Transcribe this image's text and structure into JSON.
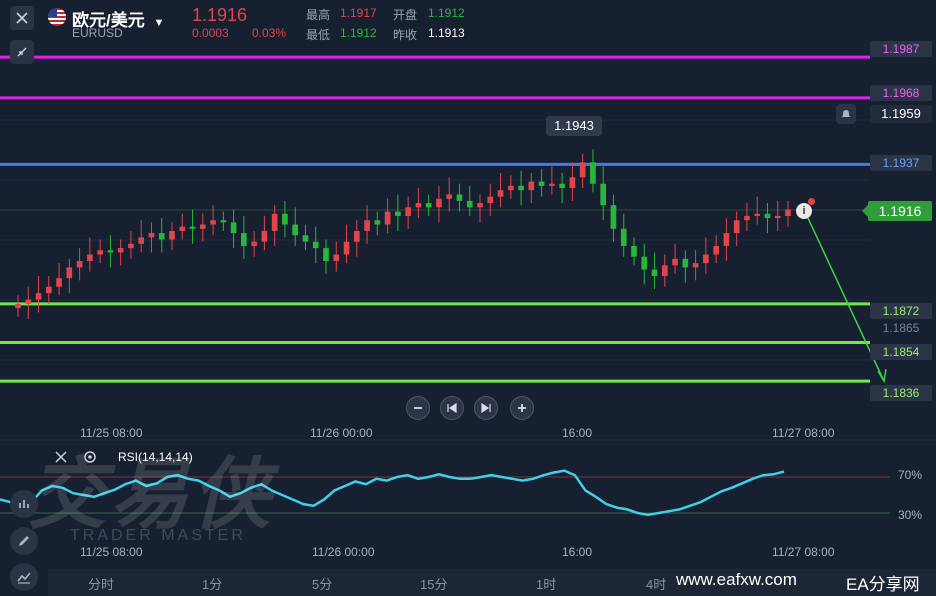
{
  "header": {
    "symbol_name": "欧元/美元",
    "symbol_code": "EURUSD",
    "price": "1.1916",
    "change": "0.0003",
    "change_pct": "0.03%",
    "high_label": "最高",
    "high_value": "1.1917",
    "open_label": "开盘",
    "open_value": "1.1912",
    "low_label": "最低",
    "low_value": "1.1912",
    "prev_close_label": "昨收",
    "prev_close_value": "1.1913"
  },
  "price_levels": {
    "level_1987": "1.1987",
    "level_1968": "1.1968",
    "alert_price": "1.1959",
    "level_1937": "1.1937",
    "current": "1.1916",
    "level_1872": "1.1872",
    "level_1865": "1.1865",
    "level_1854": "1.1854",
    "level_1836": "1.1836"
  },
  "chart_annotation": {
    "peak_label": "1.1943"
  },
  "time_axis": [
    "11/25 08:00",
    "11/26 00:00",
    "16:00",
    "11/27 08:00"
  ],
  "indicator": {
    "name": "RSI(14,14,14)",
    "level_high": "70%",
    "level_low": "30%"
  },
  "timeframe_tabs": [
    "分时",
    "1分",
    "5分",
    "15分",
    "1时",
    "4时"
  ],
  "watermark": {
    "main": "交易侠",
    "sub": "TRADER MASTER"
  },
  "footer_brand": {
    "url": "www.eafxw.com",
    "name": "EA分享网"
  },
  "colors": {
    "up": "#e0454a",
    "down": "#27b83a",
    "magenta_line": "#e020e8",
    "blue_line": "#3d7df0",
    "green_line": "#6ee84a",
    "rsi_line": "#3fd0e8"
  },
  "chart_data": {
    "type": "candlestick",
    "symbol": "EURUSD",
    "ylim": [
      1.183,
      1.1995
    ],
    "horizontal_levels": [
      1.1987,
      1.1968,
      1.1937,
      1.1872,
      1.1854,
      1.1836
    ],
    "current_price": 1.1916,
    "peak": 1.1943,
    "x_ticks": [
      "11/25 08:00",
      "11/26 00:00",
      "16:00",
      "11/27 08:00"
    ],
    "close_series": [
      1.1872,
      1.1874,
      1.1877,
      1.188,
      1.1884,
      1.1889,
      1.1892,
      1.1895,
      1.1897,
      1.1896,
      1.1898,
      1.19,
      1.1903,
      1.1905,
      1.1902,
      1.1906,
      1.1908,
      1.1907,
      1.1909,
      1.1911,
      1.191,
      1.1905,
      1.1899,
      1.1901,
      1.1906,
      1.1914,
      1.1909,
      1.1904,
      1.1901,
      1.1898,
      1.1892,
      1.1895,
      1.1901,
      1.1906,
      1.1911,
      1.1909,
      1.1915,
      1.1913,
      1.1917,
      1.1919,
      1.1917,
      1.1921,
      1.1923,
      1.192,
      1.1917,
      1.1919,
      1.1922,
      1.1925,
      1.1927,
      1.1925,
      1.1929,
      1.1927,
      1.1928,
      1.1926,
      1.1931,
      1.1938,
      1.1928,
      1.1918,
      1.1907,
      1.1899,
      1.1894,
      1.1888,
      1.1885,
      1.189,
      1.1893,
      1.1889,
      1.1891,
      1.1895,
      1.1899,
      1.1905,
      1.1911,
      1.1913,
      1.1914,
      1.1912,
      1.1913,
      1.1916
    ],
    "rsi": {
      "name": "RSI(14,14,14)",
      "levels": [
        70,
        30
      ],
      "values": [
        45,
        42,
        38,
        42,
        55,
        60,
        58,
        52,
        50,
        48,
        52,
        56,
        62,
        66,
        60,
        63,
        70,
        72,
        68,
        66,
        60,
        55,
        48,
        52,
        58,
        62,
        55,
        50,
        45,
        40,
        38,
        45,
        55,
        60,
        65,
        62,
        68,
        66,
        70,
        72,
        68,
        70,
        73,
        70,
        68,
        68,
        70,
        72,
        70,
        68,
        66,
        68,
        72,
        75,
        77,
        72,
        55,
        48,
        40,
        36,
        34,
        30,
        28,
        30,
        32,
        34,
        38,
        42,
        48,
        54,
        58,
        63,
        68,
        72,
        73,
        76
      ]
    }
  }
}
